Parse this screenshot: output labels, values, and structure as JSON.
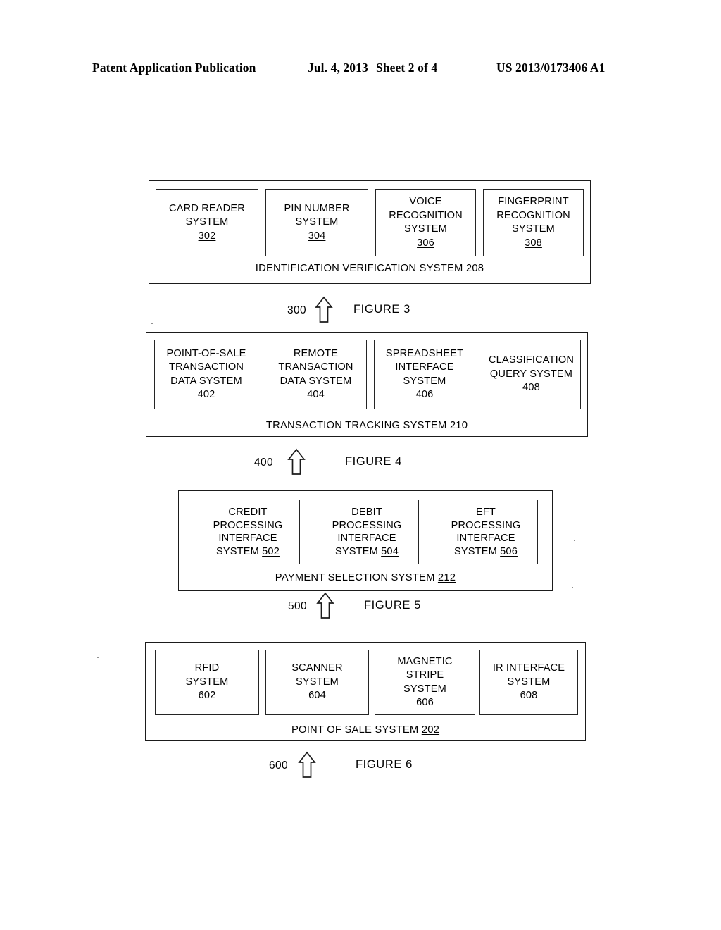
{
  "page": {
    "header": {
      "publication": "Patent Application Publication",
      "date": "Jul. 4, 2013",
      "sheet": "Sheet 2 of 4",
      "patent_number": "US 2013/0173406 A1"
    },
    "background_color": "#ffffff",
    "ink_color": "#000000"
  },
  "figures": [
    {
      "id": "figure-3",
      "number_label": "300",
      "caption": "FIGURE 3",
      "arrow_icon": "up-arrow-outline-icon",
      "container": {
        "label": "IDENTIFICATION VERIFICATION SYSTEM",
        "reference": "208"
      },
      "blocks": [
        {
          "lines": [
            "CARD READER",
            "SYSTEM"
          ],
          "reference": "302",
          "reference_inline": false
        },
        {
          "lines": [
            "PIN NUMBER",
            "SYSTEM"
          ],
          "reference": "304",
          "reference_inline": false
        },
        {
          "lines": [
            "VOICE",
            "RECOGNITION",
            "SYSTEM"
          ],
          "reference": "306",
          "reference_inline": false
        },
        {
          "lines": [
            "FINGERPRINT",
            "RECOGNITION",
            "SYSTEM"
          ],
          "reference": "308",
          "reference_inline": false
        }
      ]
    },
    {
      "id": "figure-4",
      "number_label": "400",
      "caption": "FIGURE 4",
      "arrow_icon": "up-arrow-outline-icon",
      "container": {
        "label": "TRANSACTION TRACKING SYSTEM",
        "reference": "210"
      },
      "blocks": [
        {
          "lines": [
            "POINT-OF-SALE",
            "TRANSACTION",
            "DATA SYSTEM"
          ],
          "reference": "402",
          "reference_inline": false
        },
        {
          "lines": [
            "REMOTE",
            "TRANSACTION",
            "DATA SYSTEM"
          ],
          "reference": "404",
          "reference_inline": false
        },
        {
          "lines": [
            "SPREADSHEET",
            "INTERFACE",
            "SYSTEM"
          ],
          "reference": "406",
          "reference_inline": false
        },
        {
          "lines": [
            "CLASSIFICATION",
            "QUERY SYSTEM"
          ],
          "reference": "408",
          "reference_inline": false
        }
      ]
    },
    {
      "id": "figure-5",
      "number_label": "500",
      "caption": "FIGURE 5",
      "arrow_icon": "up-arrow-outline-icon",
      "container": {
        "label": "PAYMENT SELECTION SYSTEM",
        "reference": "212"
      },
      "blocks": [
        {
          "lines": [
            "CREDIT",
            "PROCESSING",
            "INTERFACE",
            "SYSTEM"
          ],
          "reference": "502",
          "reference_inline": true
        },
        {
          "lines": [
            "DEBIT",
            "PROCESSING",
            "INTERFACE",
            "SYSTEM"
          ],
          "reference": "504",
          "reference_inline": true
        },
        {
          "lines": [
            "EFT",
            "PROCESSING",
            "INTERFACE",
            "SYSTEM"
          ],
          "reference": "506",
          "reference_inline": true
        }
      ]
    },
    {
      "id": "figure-6",
      "number_label": "600",
      "caption": "FIGURE 6",
      "arrow_icon": "up-arrow-outline-icon",
      "container": {
        "label": "POINT OF SALE SYSTEM",
        "reference": "202"
      },
      "blocks": [
        {
          "lines": [
            "RFID",
            "SYSTEM"
          ],
          "reference": "602",
          "reference_inline": false
        },
        {
          "lines": [
            "SCANNER",
            "SYSTEM"
          ],
          "reference": "604",
          "reference_inline": false
        },
        {
          "lines": [
            "MAGNETIC",
            "STRIPE",
            "SYSTEM"
          ],
          "reference": "606",
          "reference_inline": false
        },
        {
          "lines": [
            "IR INTERFACE",
            "SYSTEM"
          ],
          "reference": "608",
          "reference_inline": false
        }
      ]
    }
  ]
}
